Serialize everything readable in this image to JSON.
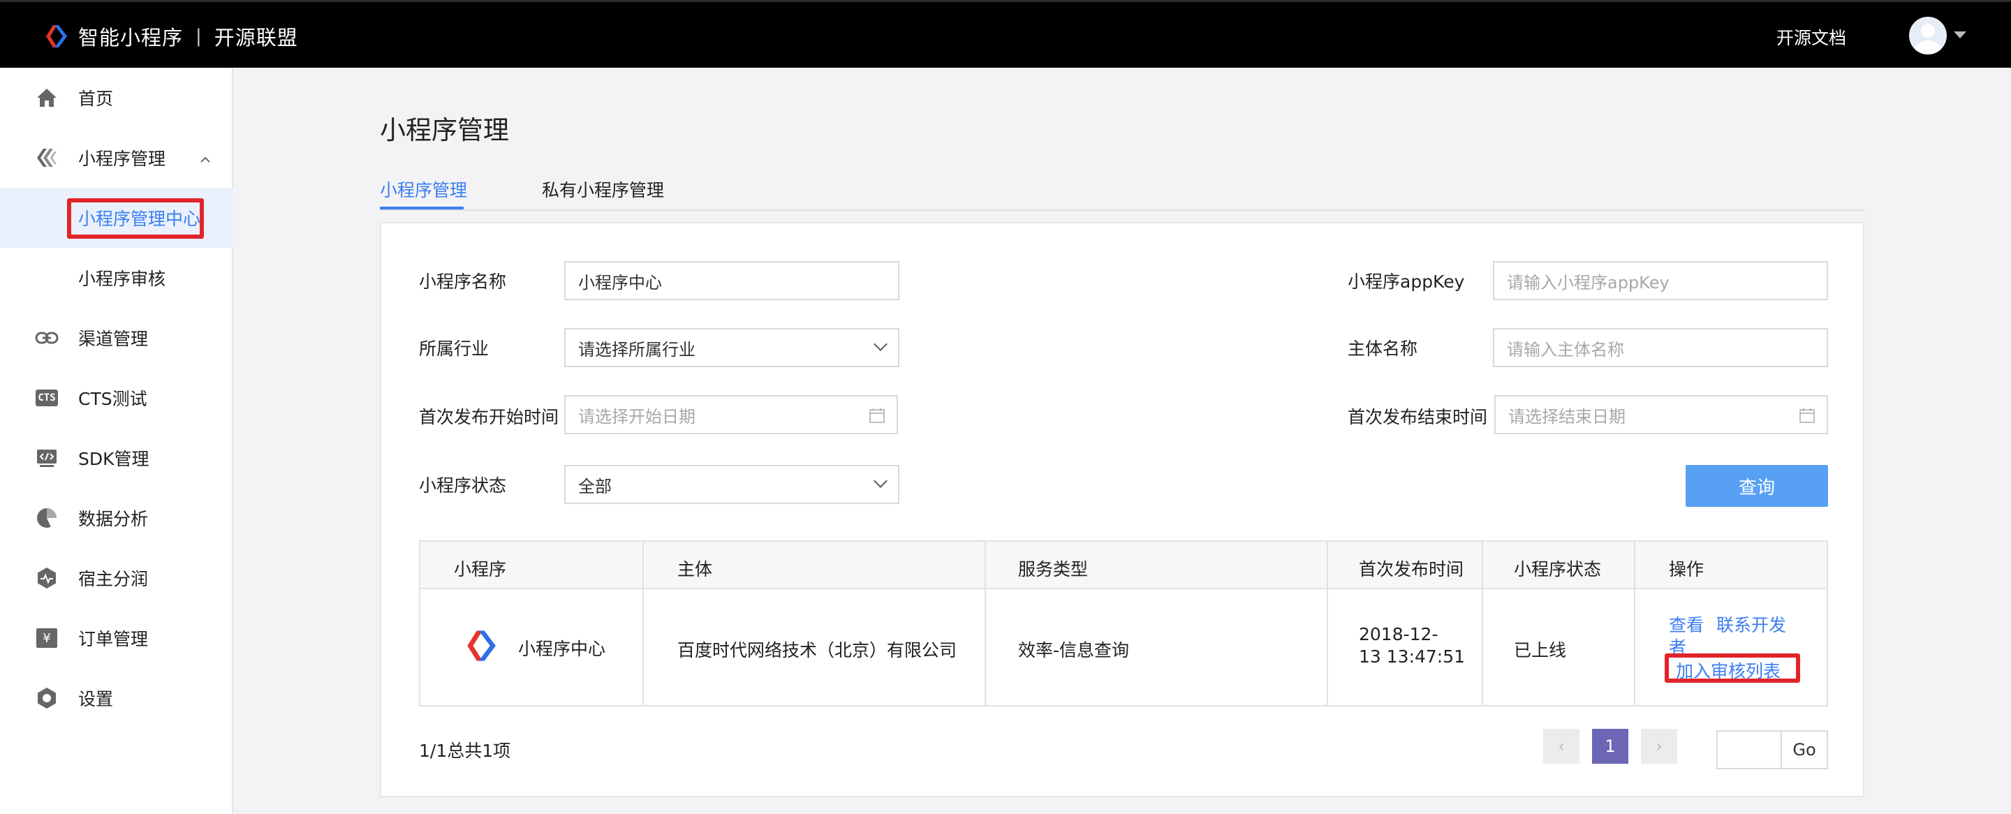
{
  "header": {
    "brand": "智能小程序",
    "separator": "|",
    "alliance": "开源联盟",
    "doc_link": "开源文档"
  },
  "sidebar": {
    "items": [
      {
        "label": "首页",
        "icon": "home-icon"
      },
      {
        "label": "小程序管理",
        "icon": "miniprogram-icon",
        "chevron": "^"
      },
      {
        "label": "小程序管理中心"
      },
      {
        "label": "小程序审核"
      },
      {
        "label": "渠道管理",
        "icon": "link-icon"
      },
      {
        "label": "CTS测试",
        "icon": "cts-icon",
        "icon_text": "CTS"
      },
      {
        "label": "SDK管理",
        "icon": "code-icon"
      },
      {
        "label": "数据分析",
        "icon": "pie-chart-icon"
      },
      {
        "label": "宿主分润",
        "icon": "pulse-icon"
      },
      {
        "label": "订单管理",
        "icon": "yen-icon",
        "icon_text": "¥"
      },
      {
        "label": "设置",
        "icon": "gear-icon"
      }
    ]
  },
  "main": {
    "title": "小程序管理",
    "tabs": [
      {
        "label": "小程序管理",
        "active": true
      },
      {
        "label": "私有小程序管理",
        "active": false
      }
    ]
  },
  "filters": {
    "name_label": "小程序名称",
    "name_value": "小程序中心",
    "appkey_label": "小程序appKey",
    "appkey_placeholder": "请输入小程序appKey",
    "industry_label": "所属行业",
    "industry_placeholder": "请选择所属行业",
    "entity_label": "主体名称",
    "entity_placeholder": "请输入主体名称",
    "start_label": "首次发布开始时间",
    "start_placeholder": "请选择开始日期",
    "end_label": "首次发布结束时间",
    "end_placeholder": "请选择结束日期",
    "status_label": "小程序状态",
    "status_value": "全部",
    "query_button": "查询"
  },
  "table": {
    "headers": [
      "小程序",
      "主体",
      "服务类型",
      "首次发布时间",
      "小程序状态",
      "操作"
    ],
    "rows": [
      {
        "name": "小程序中心",
        "entity": "百度时代网络技术（北京）有限公司",
        "service_type": "效率-信息查询",
        "publish_time_line1": "2018-12-",
        "publish_time_line2": "13 13:47:51",
        "status": "已上线",
        "action_view": "查看",
        "action_contact_line1": "联系开发",
        "action_contact_line2": "者",
        "action_add_review": "加入审核列表"
      }
    ]
  },
  "pagination": {
    "summary": "1/1总共1项",
    "prev": "‹",
    "current_page": "1",
    "next": "›",
    "go_label": "Go"
  },
  "colors": {
    "accent": "#3b7ef0",
    "highlight_box": "#e0242a",
    "header_bg": "#000000",
    "page_button": "#6c66b5",
    "query_button": "#57a0f4"
  }
}
